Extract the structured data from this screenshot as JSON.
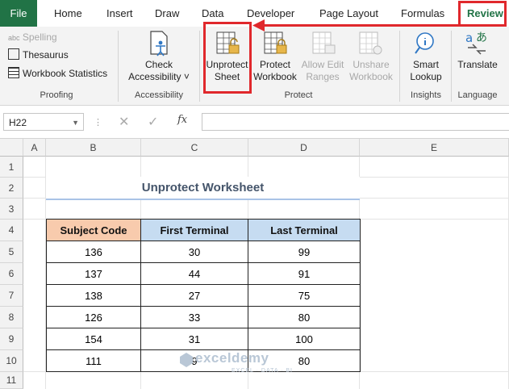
{
  "tabs": [
    "File",
    "Home",
    "Insert",
    "Draw",
    "Data",
    "Developer",
    "Page Layout",
    "Formulas",
    "Review"
  ],
  "ribbon": {
    "proofing": {
      "spelling": "Spelling",
      "thesaurus": "Thesaurus",
      "workbook_statistics": "Workbook Statistics",
      "label": "Proofing"
    },
    "accessibility": {
      "check_line1": "Check",
      "check_line2": "Accessibility ˅",
      "label": "Accessibility"
    },
    "protect": {
      "unprotect_line1": "Unprotect",
      "unprotect_line2": "Sheet",
      "protect_wb_line1": "Protect",
      "protect_wb_line2": "Workbook",
      "allow_edit_line1": "Allow Edit",
      "allow_edit_line2": "Ranges",
      "unshare_line1": "Unshare",
      "unshare_line2": "Workbook",
      "label": "Protect"
    },
    "insights": {
      "smart_line1": "Smart",
      "smart_line2": "Lookup",
      "label": "Insights"
    },
    "language": {
      "translate": "Translate",
      "label": "Language"
    }
  },
  "formula_bar": {
    "name_box": "H22",
    "fx": "fx",
    "value": ""
  },
  "columns": [
    "A",
    "B",
    "C",
    "D",
    "E"
  ],
  "rows": [
    "1",
    "2",
    "3",
    "4",
    "5",
    "6",
    "7",
    "8",
    "9",
    "10",
    "11"
  ],
  "sheet": {
    "title": "Unprotect Worksheet",
    "headers": [
      "Subject Code",
      "First Terminal",
      "Last Terminal"
    ],
    "data": [
      [
        "136",
        "30",
        "99"
      ],
      [
        "137",
        "44",
        "91"
      ],
      [
        "138",
        "27",
        "75"
      ],
      [
        "126",
        "33",
        "80"
      ],
      [
        "154",
        "31",
        "100"
      ],
      [
        "111",
        "9",
        "80"
      ]
    ]
  },
  "watermark": {
    "name": "exceldemy",
    "tagline": "EXCEL · DATA · BI"
  },
  "colors": {
    "excel_green": "#217346",
    "annotation_red": "#e0282c",
    "header_peach": "#f8cbad",
    "header_blue": "#c6dcf1"
  }
}
